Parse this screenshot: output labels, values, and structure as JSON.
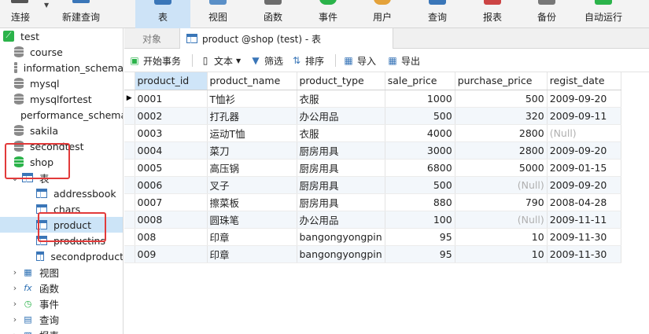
{
  "toolbar": {
    "connect": "连接",
    "new_query": "新建查询",
    "buttons": [
      "表",
      "视图",
      "函数",
      "事件",
      "用户",
      "查询",
      "报表",
      "备份",
      "自动运行"
    ]
  },
  "tree": {
    "connection": "test",
    "databases": [
      "course",
      "information_schema",
      "mysql",
      "mysqlfortest",
      "performance_schema",
      "sakila",
      "secondtest"
    ],
    "open_db": "shop",
    "tables_folder": "表",
    "tables": [
      "addressbook",
      "chars",
      "product",
      "productins",
      "secondproduct"
    ],
    "selected_table": "product",
    "categories": [
      "视图",
      "函数",
      "事件",
      "查询",
      "报表"
    ]
  },
  "tabs": {
    "objects": "对象",
    "active": "product @shop (test) - 表"
  },
  "subbar": {
    "begin_transaction": "开始事务",
    "text": "文本",
    "filter": "筛选",
    "sort": "排序",
    "import": "导入",
    "export": "导出"
  },
  "grid": {
    "columns": [
      "product_id",
      "product_name",
      "product_type",
      "sale_price",
      "purchase_price",
      "regist_date"
    ],
    "rows": [
      [
        "0001",
        "T恤衫",
        "衣服",
        "1000",
        "500",
        "2009-09-20"
      ],
      [
        "0002",
        "打孔器",
        "办公用品",
        "500",
        "320",
        "2009-09-11"
      ],
      [
        "0003",
        "运动T恤",
        "衣服",
        "4000",
        "2800",
        "(Null)"
      ],
      [
        "0004",
        "菜刀",
        "厨房用具",
        "3000",
        "2800",
        "2009-09-20"
      ],
      [
        "0005",
        "高压锅",
        "厨房用具",
        "6800",
        "5000",
        "2009-01-15"
      ],
      [
        "0006",
        "叉子",
        "厨房用具",
        "500",
        "(Null)",
        "2009-09-20"
      ],
      [
        "0007",
        "擦菜板",
        "厨房用具",
        "880",
        "790",
        "2008-04-28"
      ],
      [
        "0008",
        "圆珠笔",
        "办公用品",
        "100",
        "(Null)",
        "2009-11-11"
      ],
      [
        "008",
        "印章",
        "bangongyongpin",
        "95",
        "10",
        "2009-11-30"
      ],
      [
        "009",
        "印章",
        "bangongyongpin",
        "95",
        "10",
        "2009-11-30"
      ]
    ]
  },
  "colors": {
    "accent": "#cde3f7",
    "highlight_box": "#e23a3a",
    "db_active": "#2bb34a"
  }
}
